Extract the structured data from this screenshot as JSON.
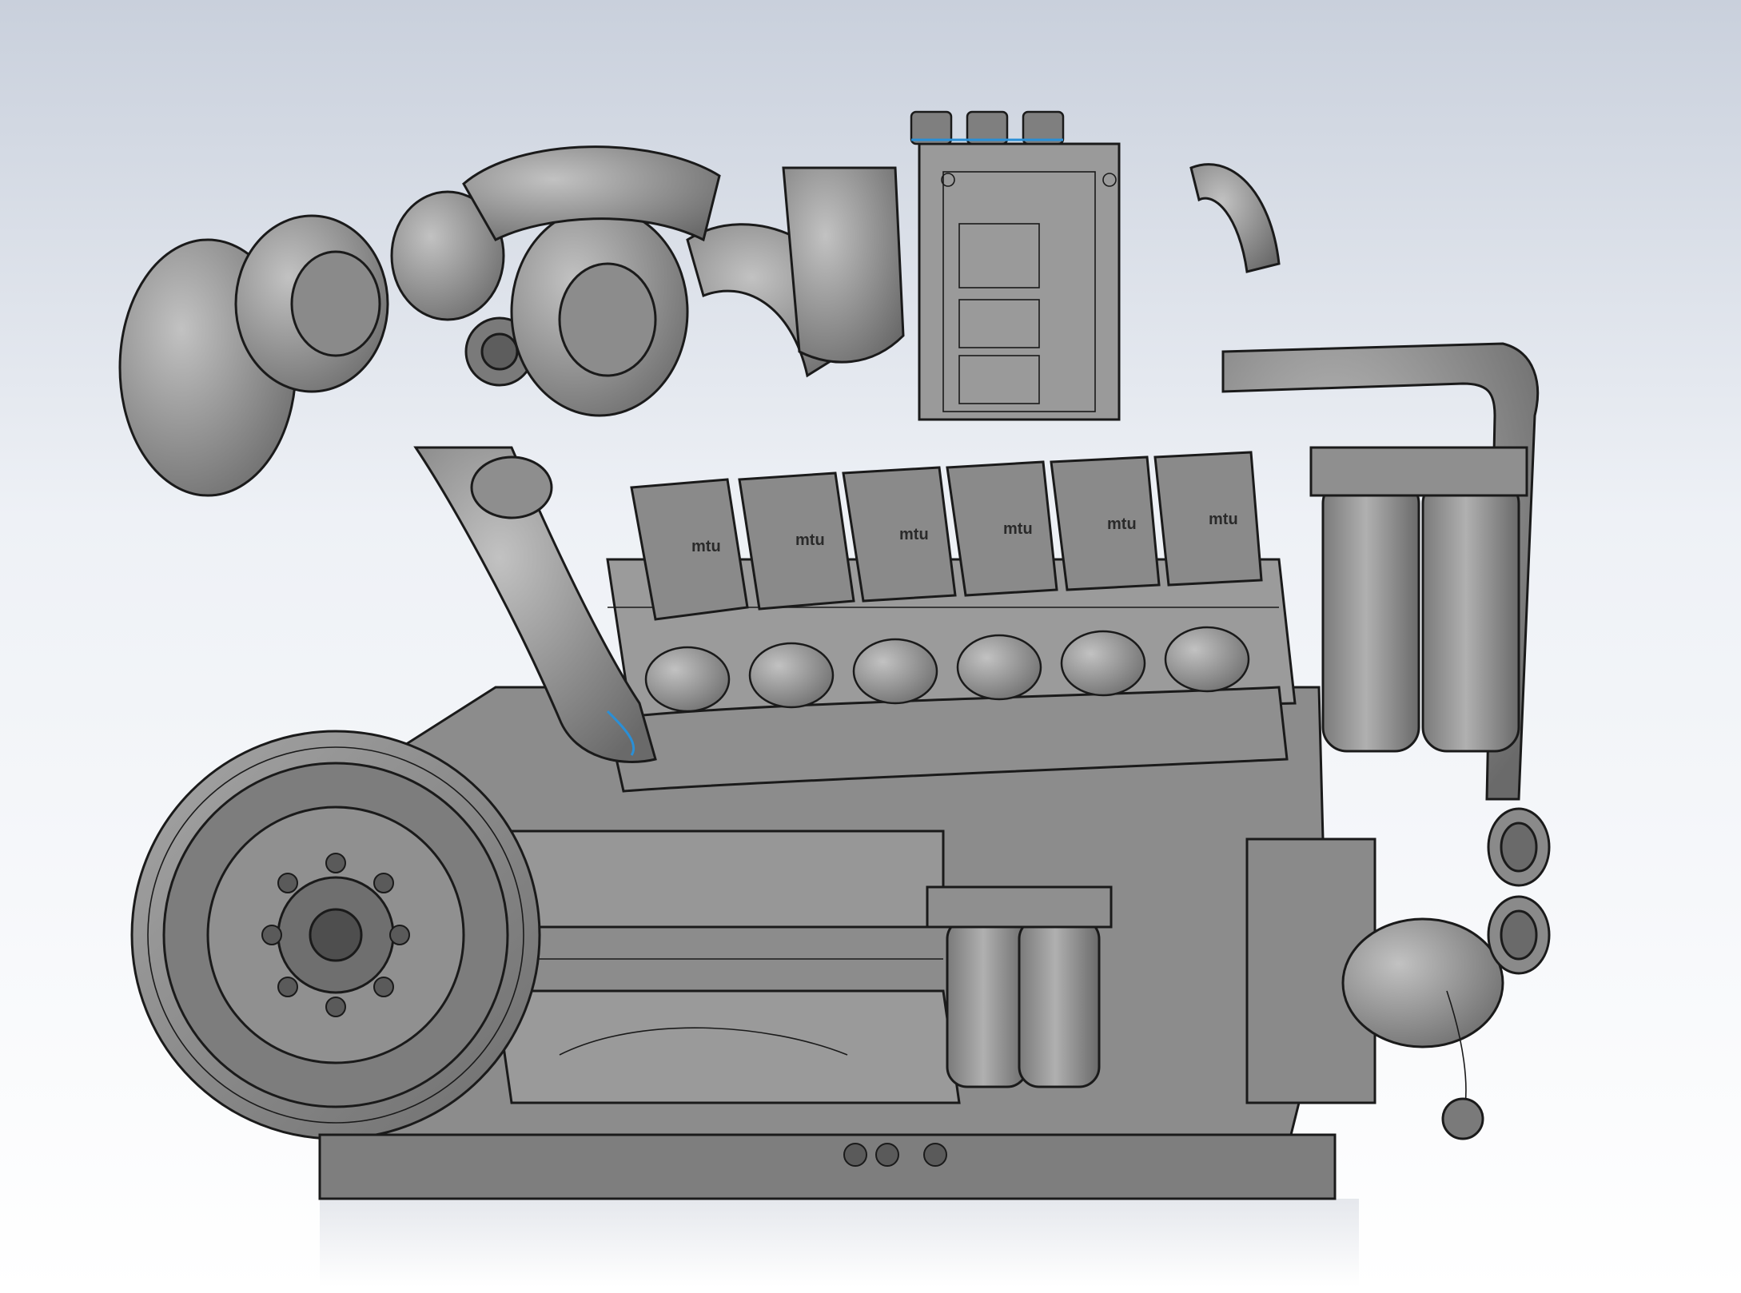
{
  "viewport": {
    "background_top": "#c9d0dc",
    "background_bottom": "#ffffff"
  },
  "model": {
    "subject": "V12 diesel engine CAD assembly (shaded with edges)",
    "cylinder_heads": [
      {
        "label": "mtu"
      },
      {
        "label": "mtu"
      },
      {
        "label": "mtu"
      },
      {
        "label": "mtu"
      },
      {
        "label": "mtu"
      },
      {
        "label": "mtu"
      }
    ],
    "colors": {
      "body": "#8a8a8a",
      "body_light": "#a9a9a9",
      "body_dark": "#5e5e5e",
      "edges": "#1a1a1a",
      "highlight_edges": "#2a8fd6"
    }
  }
}
